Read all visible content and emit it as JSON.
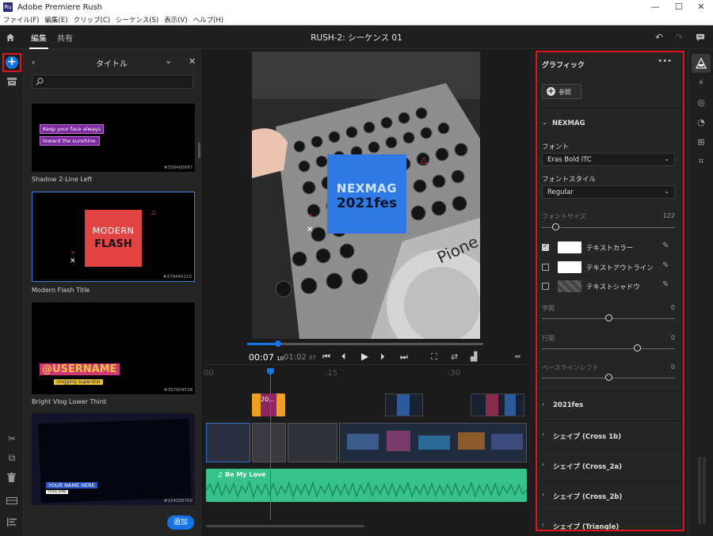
{
  "window": {
    "title": "Adobe Premiere Rush",
    "app_badge": "Ru",
    "minimize": "—",
    "maximize": "☐",
    "close": "✕"
  },
  "menu": [
    "ファイル(F)",
    "編集(E)",
    "クリップ(C)",
    "シーケンス(S)",
    "表示(V)",
    "ヘルプ(H)"
  ],
  "header": {
    "tabs": [
      "編集",
      "共有"
    ],
    "sequence_title": "RUSH-2: シーケンス 01"
  },
  "title_panel": {
    "heading": "タイトル",
    "search_placeholder": "",
    "items": [
      {
        "caption": "Shadow 2-Line Left",
        "id": "#358400687",
        "line1": "Keep your face always",
        "line2": "toward the sunshine."
      },
      {
        "caption": "Modern Flash Title",
        "id": "#379445210",
        "text1": "MODERN",
        "text2": "FLASH"
      },
      {
        "caption": "Bright Vlog Lower Third",
        "id": "#357904538",
        "text1": "@USERNAME",
        "text2": "vlogging superstar"
      },
      {
        "caption": "",
        "id": "#224256700",
        "text1": "YOUR NAME HERE",
        "text2": "TITLE LINE"
      }
    ],
    "add_button": "追加"
  },
  "preview": {
    "title_line1": "NEXMAG",
    "title_line2": "2021fes"
  },
  "transport": {
    "current_time": "00:07",
    "current_frames": "10",
    "total_time": "01:02",
    "total_frames": "07"
  },
  "timeline": {
    "ruler": [
      "00",
      ":15",
      ":30"
    ],
    "title_clip_label": "20...",
    "audio_clip_label": "Be My Love"
  },
  "graphics_panel": {
    "title": "グラフィック",
    "more": "•••",
    "browse_button": "参照",
    "group_name": "NEXMAG",
    "font_label": "フォント",
    "font_value": "Eras Bold ITC",
    "font_style_label": "フォントスタイル",
    "font_style_value": "Regular",
    "font_size_label": "フォントサイズ",
    "font_size_value": "122",
    "text_color_label": "テキストカラー",
    "text_outline_label": "テキストアウトライン",
    "text_shadow_label": "テキストシャドウ",
    "tracking_label": "字間",
    "tracking_value": "0",
    "leading_label": "行間",
    "leading_value": "0",
    "baseline_label": "ベースラインシフト",
    "baseline_value": "0",
    "sections": [
      "2021fes",
      "シェイプ (Cross 1b)",
      "シェイプ (Cross_2a)",
      "シェイプ (Cross_2b)",
      "シェイプ (Triangle)"
    ]
  },
  "colors": {
    "accent_red": "#e0141e",
    "accent_blue": "#1473e6",
    "audio_green": "#36c28a",
    "title_clip_orange": "#f0a020"
  }
}
